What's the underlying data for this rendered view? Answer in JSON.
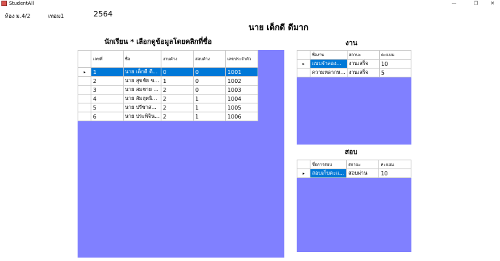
{
  "window": {
    "title": "StudentAll",
    "minimize": "—",
    "restore": "❐",
    "close": "✕"
  },
  "header": {
    "room": "ห้อง ม.4/2",
    "term": "เทอม1",
    "year": "2564"
  },
  "selected_student": "นาย เด็กดี ดีมาก",
  "students": {
    "title": "นักเรียน * เลือกดูข้อมูลโดยคลิกที่ชื่อ",
    "columns": [
      "เลขที่",
      "ชื่อ",
      "งานค้าง",
      "สอบค้าง",
      "เลขประจำตัว"
    ],
    "rows": [
      [
        "1",
        "นาย เด็กดี ดี...",
        "0",
        "0",
        "1001"
      ],
      [
        "2",
        "นาย สุขชัย ข...",
        "1",
        "0",
        "1002"
      ],
      [
        "3",
        "นาย สมชาย ...",
        "2",
        "0",
        "1003"
      ],
      [
        "4",
        "นาย สัมฤทธิ...",
        "2",
        "1",
        "1004"
      ],
      [
        "5",
        "นาย ปรีชาส...",
        "2",
        "1",
        "1005"
      ],
      [
        "6",
        "นาย ประพิจิน...",
        "2",
        "1",
        "1006"
      ]
    ]
  },
  "works": {
    "title": "งาน",
    "columns": [
      "ชื่องาน",
      "สถานะ",
      "คะแนน"
    ],
    "rows": [
      [
        "แบบจำลอง...",
        "งานเสร็จ",
        "10"
      ],
      [
        "ความหลากห...",
        "งานเสร็จ",
        "5"
      ]
    ]
  },
  "exams": {
    "title": "สอบ",
    "columns": [
      "ชื่อการสอบ",
      "สถานะ",
      "คะแนน"
    ],
    "rows": [
      [
        "สอบเก็บคะแ...",
        "สอบผ่าน",
        "10"
      ]
    ]
  },
  "colors": {
    "grid_background": "#8080ff",
    "selection": "#0078d7"
  },
  "row_indicator": "▸"
}
